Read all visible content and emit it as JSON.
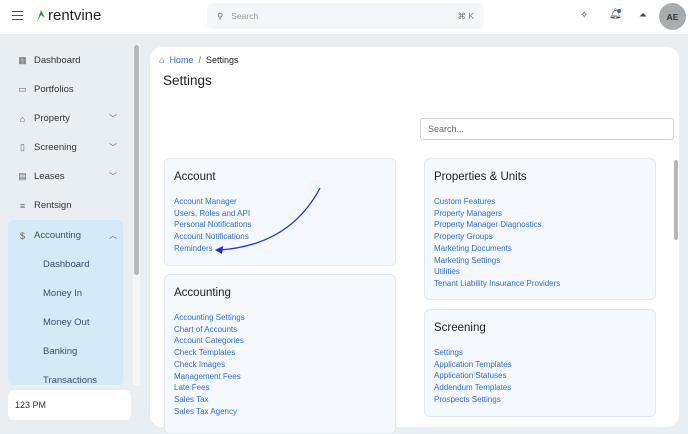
{
  "header": {
    "brand": "rentvine",
    "search_placeholder": "Search",
    "search_shortcut": "⌘ K",
    "avatar": "AE"
  },
  "sidebar": {
    "items": [
      {
        "label": "Dashboard",
        "icon": "grid-icon"
      },
      {
        "label": "Portfolios",
        "icon": "folder-icon"
      },
      {
        "label": "Property",
        "icon": "building-icon"
      },
      {
        "label": "Screening",
        "icon": "document-search-icon"
      },
      {
        "label": "Leases",
        "icon": "clipboard-icon"
      },
      {
        "label": "Rentsign",
        "icon": "signature-icon"
      },
      {
        "label": "Accounting",
        "icon": "dollar-icon"
      }
    ],
    "accounting_sub": [
      "Dashboard",
      "Money In",
      "Money Out",
      "Banking",
      "Transactions"
    ],
    "footer_text": "123 PM"
  },
  "breadcrumb": {
    "home": "Home",
    "current": "Settings"
  },
  "page_title": "Settings",
  "search_placeholder": "Search...",
  "cards": {
    "account": {
      "title": "Account",
      "links": [
        "Account Manager",
        "Users, Roles and API",
        "Personal Notifications",
        "Account Notifications",
        "Reminders"
      ]
    },
    "accounting": {
      "title": "Accounting",
      "links": [
        "Accounting Settings",
        "Chart of Accounts",
        "Account Categories",
        "Check Templates",
        "Check Images",
        "Management Fees",
        "Late Fees",
        "Sales Tax",
        "Sales Tax Agency"
      ]
    },
    "properties": {
      "title": "Properties & Units",
      "links": [
        "Custom Features",
        "Property Managers",
        "Property Manager Diagnostics",
        "Property Groups",
        "Marketing Documents",
        "Marketing Settings",
        "Utilities",
        "Tenant Liability Insurance Providers"
      ]
    },
    "screening": {
      "title": "Screening",
      "links": [
        "Settings",
        "Application Templates",
        "Application Statuses",
        "Addendum Templates",
        "Prospects Settings"
      ]
    }
  },
  "colors": {
    "link": "#2f6fcf",
    "accent_block": "#d4eaf7",
    "annotation_arrow": "#1a2fe0"
  }
}
